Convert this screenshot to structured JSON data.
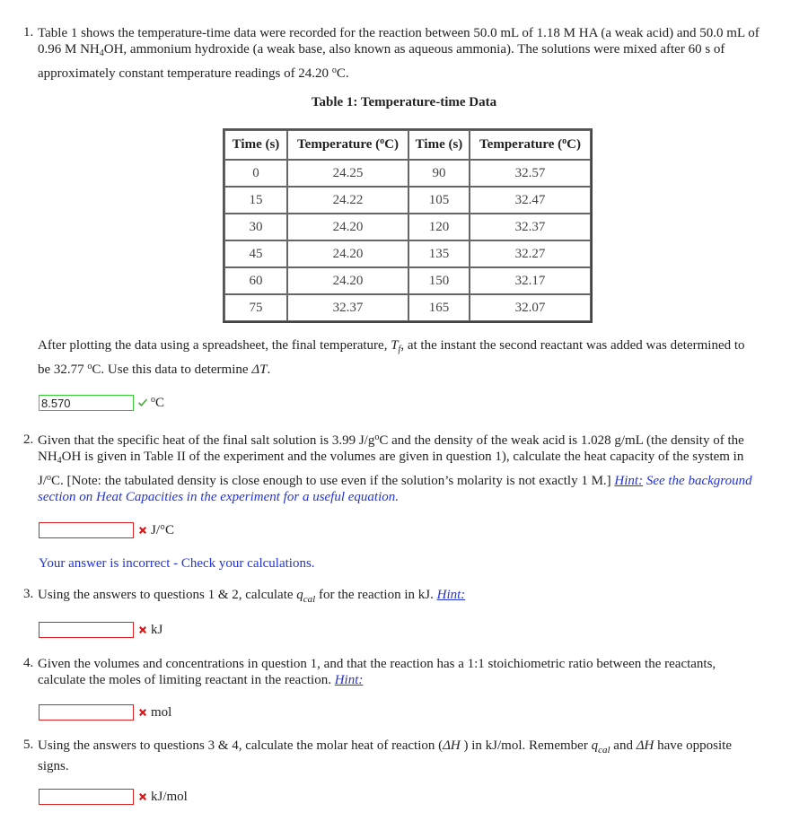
{
  "questions": {
    "q1": {
      "number": "1.",
      "text_line1": "Table 1 shows the temperature-time data were recorded for the reaction between 50.0 mL of 1.18 M HA (a weak acid) and 50.0 mL of",
      "text_line2_pre": "0.96 M NH",
      "text_line2_sub": "4",
      "text_line2_post": "OH, ammonium hydroxide (a weak base, also known as aqueous ammonia). The solutions were mixed after 60 s of",
      "text_line3_pre": "approximately constant temperature readings of 24.20 ",
      "text_line3_deg": "o",
      "text_line3_post": "C.",
      "table": {
        "caption": "Table 1: Temperature-time Data",
        "headers": [
          "Time (s)",
          "Temperature (",
          "C)",
          "Time (s)",
          "Temperature (",
          "C)"
        ],
        "header_deg": "o",
        "rows": [
          [
            "0",
            "24.25",
            "90",
            "32.57"
          ],
          [
            "15",
            "24.22",
            "105",
            "32.47"
          ],
          [
            "30",
            "24.20",
            "120",
            "32.37"
          ],
          [
            "45",
            "24.20",
            "135",
            "32.27"
          ],
          [
            "60",
            "24.20",
            "150",
            "32.17"
          ],
          [
            "75",
            "32.37",
            "165",
            "32.07"
          ]
        ]
      },
      "after_line1_pre": "After plotting the data using a spreadsheet, the final temperature, ",
      "after_Tf_T": "T",
      "after_Tf_sub": "f",
      "after_line1_post": ", at the instant the second reactant was added was determined to",
      "after_line2_pre": "be 32.77 ",
      "after_line2_deg": "o",
      "after_line2_mid": "C. Use this data to determine ",
      "after_line2_delta": "ΔT",
      "after_line2_post": ".",
      "answer_value": "8.570",
      "answer_status": "correct",
      "unit_deg": "o",
      "unit": "C"
    },
    "q2": {
      "number": "2.",
      "line1_pre": "Given that the specific heat of the final salt solution is 3.99 J/g",
      "line1_deg": "o",
      "line1_post": "C and the density of the weak acid is 1.028 g/mL (the density of the",
      "line2_pre": "NH",
      "line2_sub": "4",
      "line2_post": "OH is given in Table II of the experiment and the volumes are given in question 1), calculate the heat capacity of the system in",
      "line3_pre": "J/",
      "line3_deg": "o",
      "line3_post": "C. [Note: the tabulated density is close enough to use even if the solution’s molarity is not exactly 1 M.] ",
      "hint_link": "Hint:",
      "hint_text_1": " See the background",
      "hint_text_2": "section on Heat Capacities in the experiment for a useful equation.",
      "answer_value": "",
      "answer_status": "incorrect",
      "unit": "J/°C",
      "feedback": "Your answer is incorrect - Check your calculations."
    },
    "q3": {
      "number": "3.",
      "text_pre": "Using the answers to questions 1 & 2, calculate ",
      "q_symbol": "q",
      "q_sub": "cal",
      "text_post": " for the reaction in kJ. ",
      "hint_link": "Hint:",
      "answer_value": "",
      "answer_status": "incorrect",
      "unit": "kJ"
    },
    "q4": {
      "number": "4.",
      "line1": "Given the volumes and concentrations in question 1, and that the reaction has a 1:1 stoichiometric ratio between the reactants,",
      "line2": "calculate the moles of limiting reactant in the reaction. ",
      "hint_link": "Hint:",
      "answer_value": "",
      "answer_status": "incorrect",
      "unit": "mol"
    },
    "q5": {
      "number": "5.",
      "line1_pre": "Using the answers to questions 3 & 4, calculate the molar heat of reaction (",
      "delta_H": "ΔH",
      "line1_mid": " ) in kJ/mol. Remember ",
      "q_symbol": "q",
      "q_sub": "cal",
      "line1_mid2": " and  ",
      "delta_H2": "ΔH",
      "line1_post": " have opposite",
      "line2": "signs.",
      "answer_value": "",
      "answer_status": "incorrect",
      "unit": "kJ/mol"
    }
  },
  "colors": {
    "correct_border": "#33cc33",
    "incorrect_border": "#e02020",
    "link_blue": "#2233dd"
  }
}
